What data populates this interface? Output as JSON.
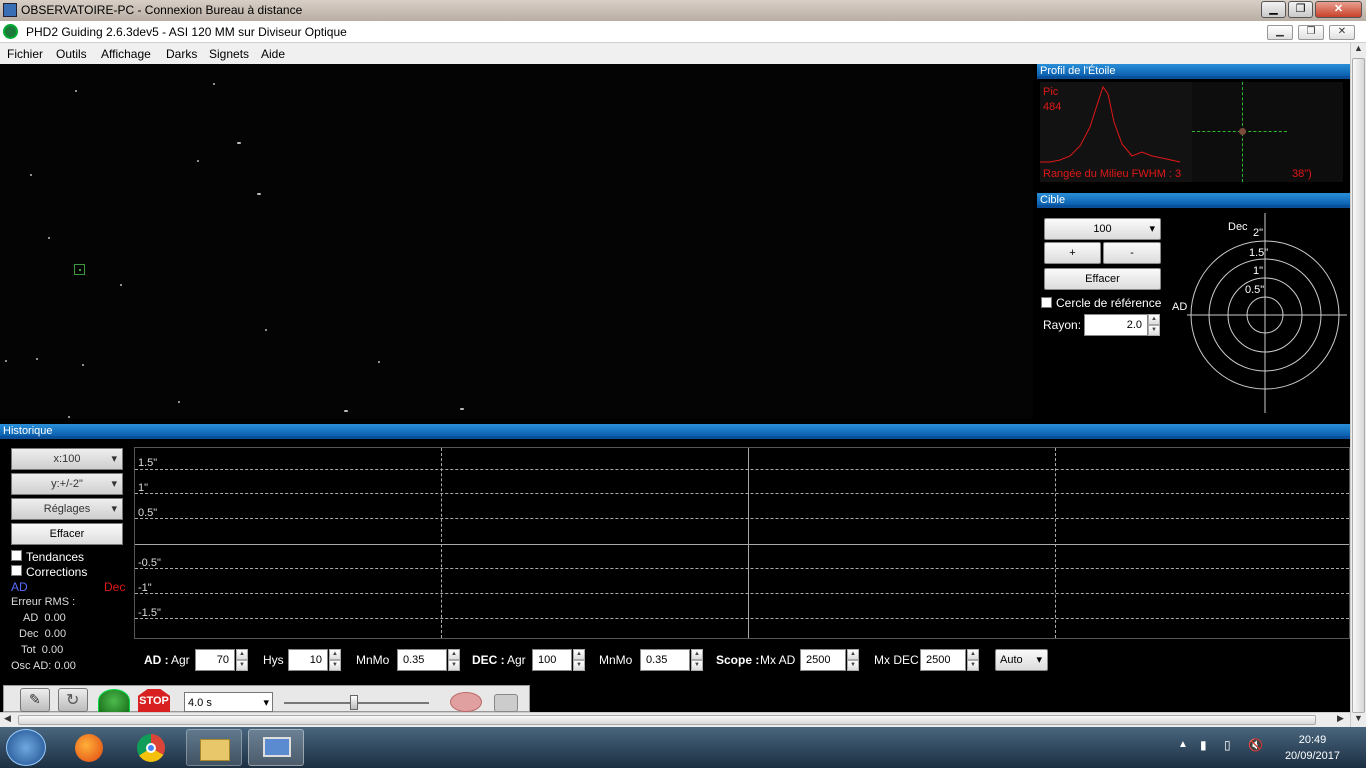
{
  "rdp_window": {
    "title": "OBSERVATOIRE-PC - Connexion Bureau à distance"
  },
  "app": {
    "title": "PHD2 Guiding 2.6.3dev5 - ASI 120 MM sur Diviseur Optique"
  },
  "menu": [
    "Fichier",
    "Outils",
    "Affichage",
    "Darks",
    "Signets",
    "Aide"
  ],
  "star_profile": {
    "header": "Profil de l'Étoile",
    "peak_label": "Pic",
    "peak_value": "484",
    "fwhm_text": "Rangée du Milieu FWHM : 3",
    "fwhm_suffix": "38\")",
    "colors": {
      "text": "#e01818",
      "curve": "#e01818",
      "crosshair": "#2db82d"
    }
  },
  "target": {
    "header": "Cible",
    "zoom_value": "100",
    "plus_label": "+",
    "minus_label": "-",
    "clear_label": "Effacer",
    "reference_circle_label": "Cercle de référence",
    "radius_label": "Rayon:",
    "radius_value": "2.0",
    "axis_dec": "Dec",
    "axis_ra": "AD",
    "ring_labels": [
      "2\"",
      "1.5\"",
      "1\"",
      "0.5\""
    ]
  },
  "history": {
    "header": "Historique",
    "x_scale": "x:100",
    "y_scale": "y:+/-2\"",
    "settings": "Réglages",
    "clear_label": "Effacer",
    "trends_label": "Tendances",
    "corrections_label": "Corrections",
    "ra_label": "AD",
    "dec_label": "Dec",
    "rms_title": "Erreur RMS :",
    "rms_ra": "AD  0.00",
    "rms_dec": "Dec  0.00",
    "rms_tot": "Tot  0.00",
    "osc_ra": "Osc AD: 0.00",
    "y_labels": [
      "1.5\"",
      "1\"",
      "0.5\"",
      "-0.5\"",
      "-1\"",
      "-1.5\""
    ],
    "colors": {
      "ra": "#5a6cff",
      "dec": "#e01818"
    }
  },
  "params": {
    "ra_label": "AD :",
    "ra_aggr_label": "Agr",
    "ra_aggr": "70",
    "hys_label": "Hys",
    "hys": "10",
    "ra_minmo_label": "MnMo",
    "ra_minmo": "0.35",
    "dec_label": "DEC :",
    "dec_aggr_label": "Agr",
    "dec_aggr": "100",
    "dec_minmo_label": "MnMo",
    "dec_minmo": "0.35",
    "scope_label": "Scope :",
    "max_ra_label": "Mx AD",
    "max_ra": "2500",
    "max_dec_label": "Mx DEC",
    "max_dec": "2500",
    "dec_mode": "Auto"
  },
  "toolbar": {
    "exposure": "4.0 s",
    "stop_label": "STOP"
  },
  "taskbar": {
    "time": "20:49",
    "date": "20/09/2017"
  }
}
